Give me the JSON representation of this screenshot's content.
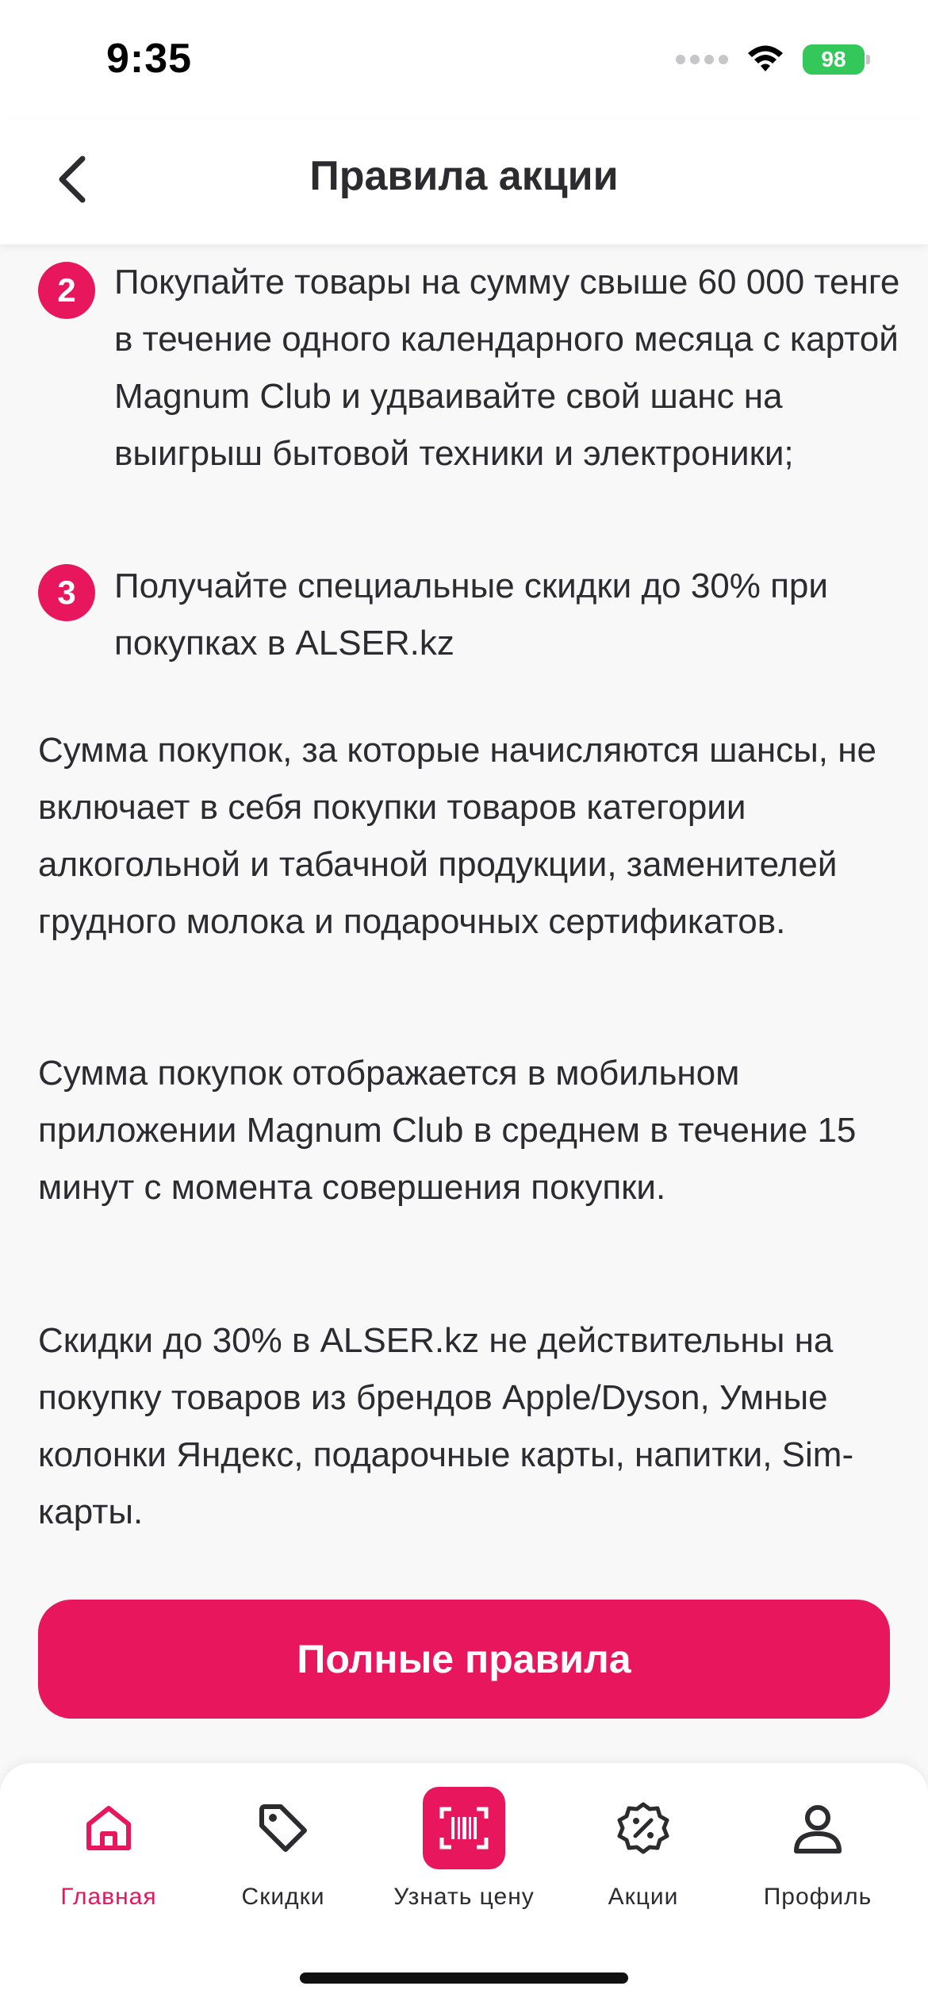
{
  "status_bar": {
    "time": "9:35",
    "battery": "98"
  },
  "header": {
    "title": "Правила акции"
  },
  "steps": [
    {
      "number": "2",
      "text": "Покупайте товары на сумму свыше 60 000 тенге в течение одного календарного месяца с картой Magnum Club и удваивайте свой шанс на выигрыш бытовой техники и электроники;"
    },
    {
      "number": "3",
      "text": "Получайте специальные скидки до 30% при покупках в ALSER.kz"
    }
  ],
  "paragraphs": [
    "Сумма покупок, за которые начисляются шансы, не включает в себя покупки товаров категории алкогольной и табачной продукции, заменителей грудного молока и подарочных сертификатов.",
    "Сумма покупок отображается в мобильном приложении Magnum Club в среднем в течение 15 минут с момента совершения покупки.",
    "Скидки до 30% в ALSER.kz не действительны на покупку товаров из брендов Apple/Dyson, Умные колонки Яндекс, подарочные карты, напитки, Sim-карты."
  ],
  "full_rules_button": "Полные правила",
  "tab_bar": {
    "items": [
      {
        "label": "Главная",
        "icon": "home-icon",
        "active": true
      },
      {
        "label": "Скидки",
        "icon": "tag-icon",
        "active": false
      },
      {
        "label": "Узнать цену",
        "icon": "barcode-scan-icon",
        "active": false
      },
      {
        "label": "Акции",
        "icon": "percent-badge-icon",
        "active": false
      },
      {
        "label": "Профиль",
        "icon": "profile-icon",
        "active": false
      }
    ]
  },
  "colors": {
    "accent": "#e8175d",
    "text": "#2b2b30",
    "background": "#f8f8f9"
  }
}
